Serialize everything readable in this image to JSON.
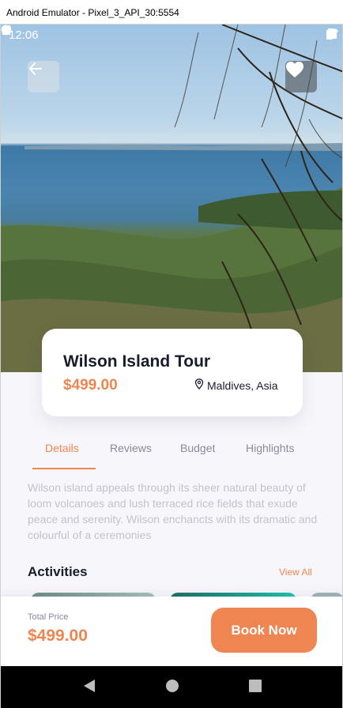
{
  "window": {
    "title": "Android Emulator - Pixel_3_API_30:5554"
  },
  "statusbar": {
    "time": "12:06"
  },
  "header": {
    "back_icon": "arrow-left-icon",
    "favorite_icon": "heart-icon"
  },
  "tour": {
    "title": "Wilson Island Tour",
    "price": "$499.00",
    "location": "Maldives, Asia",
    "location_icon": "map-pin-icon"
  },
  "tabs": [
    {
      "label": "Details",
      "active": true
    },
    {
      "label": "Reviews",
      "active": false
    },
    {
      "label": "Budget",
      "active": false
    },
    {
      "label": "Highlights",
      "active": false
    }
  ],
  "description": "Wilson island appeals through its sheer natural beauty of loom volcanoes and lush terraced rice fields that exude peace and  serenity. Wilson enchancts with its dramatic and colourful of a ceremonies",
  "activities": {
    "title": "Activities",
    "view_all": "View All"
  },
  "footer": {
    "total_label": "Total Price",
    "total_price": "$499.00",
    "book_label": "Book Now"
  },
  "colors": {
    "accent": "#ef8550",
    "text_dark": "#1b1b2e",
    "muted": "#8a8a98"
  }
}
